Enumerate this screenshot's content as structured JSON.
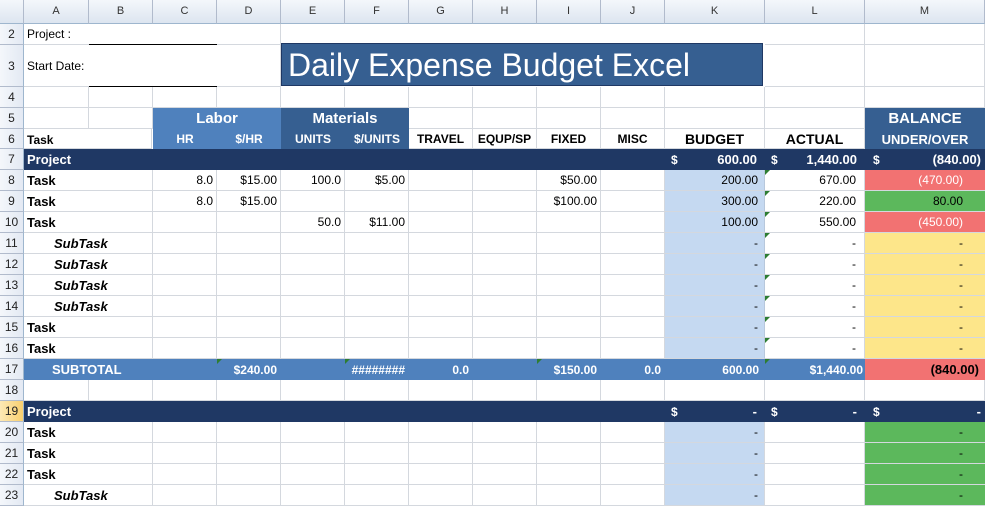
{
  "columns": [
    "",
    "A",
    "B",
    "C",
    "D",
    "E",
    "F",
    "G",
    "H",
    "I",
    "J",
    "K",
    "L",
    "M"
  ],
  "row_numbers": [
    "2",
    "3",
    "4",
    "5",
    "6",
    "7",
    "8",
    "9",
    "10",
    "11",
    "12",
    "13",
    "14",
    "15",
    "16",
    "17",
    "18",
    "19",
    "20",
    "21",
    "22",
    "23"
  ],
  "header": {
    "project_label": "Project :",
    "start_date_label": "Start Date:",
    "title": "Daily Expense Budget Excel"
  },
  "labels": {
    "labor": "Labor",
    "materials": "Materials",
    "balance": "BALANCE",
    "task": "Task",
    "hr": "HR",
    "per_hr": "$/HR",
    "units": "UNITS",
    "per_units": "$/UNITS",
    "travel": "TRAVEL",
    "equp": "EQUP/SP",
    "fixed": "FIXED",
    "misc": "MISC",
    "budget": "BUDGET",
    "actual": "ACTUAL",
    "under_over": "UNDER/OVER"
  },
  "project1": {
    "name": "Project",
    "budget_sym": "$",
    "budget": "600.00",
    "actual_sym": "$",
    "actual": "1,440.00",
    "balance_sym": "$",
    "balance": "(840.00)"
  },
  "tasks": [
    {
      "name": "Task",
      "hr": "8.0",
      "rate": "$15.00",
      "units": "100.0",
      "unit_cost": "$5.00",
      "travel": "",
      "equp": "",
      "fixed": "$50.00",
      "misc": "",
      "budget": "200.00",
      "actual": "670.00",
      "balance": "(470.00)",
      "status": "over"
    },
    {
      "name": "Task",
      "hr": "8.0",
      "rate": "$15.00",
      "units": "",
      "unit_cost": "",
      "travel": "",
      "equp": "",
      "fixed": "$100.00",
      "misc": "",
      "budget": "300.00",
      "actual": "220.00",
      "balance": "80.00",
      "status": "under"
    },
    {
      "name": "Task",
      "hr": "",
      "rate": "",
      "units": "50.0",
      "unit_cost": "$11.00",
      "travel": "",
      "equp": "",
      "fixed": "",
      "misc": "",
      "budget": "100.00",
      "actual": "550.00",
      "balance": "(450.00)",
      "status": "over"
    },
    {
      "name": "SubTask",
      "hr": "",
      "rate": "",
      "units": "",
      "unit_cost": "",
      "travel": "",
      "equp": "",
      "fixed": "",
      "misc": "",
      "budget": "-",
      "actual": "-",
      "balance": "-",
      "status": "zero"
    },
    {
      "name": "SubTask",
      "hr": "",
      "rate": "",
      "units": "",
      "unit_cost": "",
      "travel": "",
      "equp": "",
      "fixed": "",
      "misc": "",
      "budget": "-",
      "actual": "-",
      "balance": "-",
      "status": "zero"
    },
    {
      "name": "SubTask",
      "hr": "",
      "rate": "",
      "units": "",
      "unit_cost": "",
      "travel": "",
      "equp": "",
      "fixed": "",
      "misc": "",
      "budget": "-",
      "actual": "-",
      "balance": "-",
      "status": "zero"
    },
    {
      "name": "SubTask",
      "hr": "",
      "rate": "",
      "units": "",
      "unit_cost": "",
      "travel": "",
      "equp": "",
      "fixed": "",
      "misc": "",
      "budget": "-",
      "actual": "-",
      "balance": "-",
      "status": "zero"
    },
    {
      "name": "Task",
      "hr": "",
      "rate": "",
      "units": "",
      "unit_cost": "",
      "travel": "",
      "equp": "",
      "fixed": "",
      "misc": "",
      "budget": "-",
      "actual": "-",
      "balance": "-",
      "status": "zero"
    },
    {
      "name": "Task",
      "hr": "",
      "rate": "",
      "units": "",
      "unit_cost": "",
      "travel": "",
      "equp": "",
      "fixed": "",
      "misc": "",
      "budget": "-",
      "actual": "-",
      "balance": "-",
      "status": "zero"
    }
  ],
  "subtotal": {
    "label": "SUBTOTAL",
    "labor": "$240.00",
    "materials": "########",
    "travel": "0.0",
    "fixed": "$150.00",
    "misc": "0.0",
    "budget": "600.00",
    "actual": "$1,440.00",
    "balance": "(840.00)"
  },
  "project2": {
    "name": "Project",
    "budget_sym": "$",
    "budget": "-",
    "actual_sym": "$",
    "actual": "-",
    "balance_sym": "$",
    "balance": "-"
  },
  "tasks2": [
    {
      "name": "Task",
      "budget": "-",
      "balance": "-"
    },
    {
      "name": "Task",
      "budget": "-",
      "balance": "-"
    },
    {
      "name": "Task",
      "budget": "-",
      "balance": "-"
    },
    {
      "name": "SubTask",
      "budget": "-",
      "balance": "-"
    }
  ],
  "colors": {
    "navy": "#1f3864",
    "header_blue": "#4f81bd",
    "dark_blue": "#365f91",
    "budget_fill": "#c5d9f1",
    "over_red": "#f27272",
    "under_green": "#5cb85c",
    "zero_yellow": "#fde68a"
  }
}
